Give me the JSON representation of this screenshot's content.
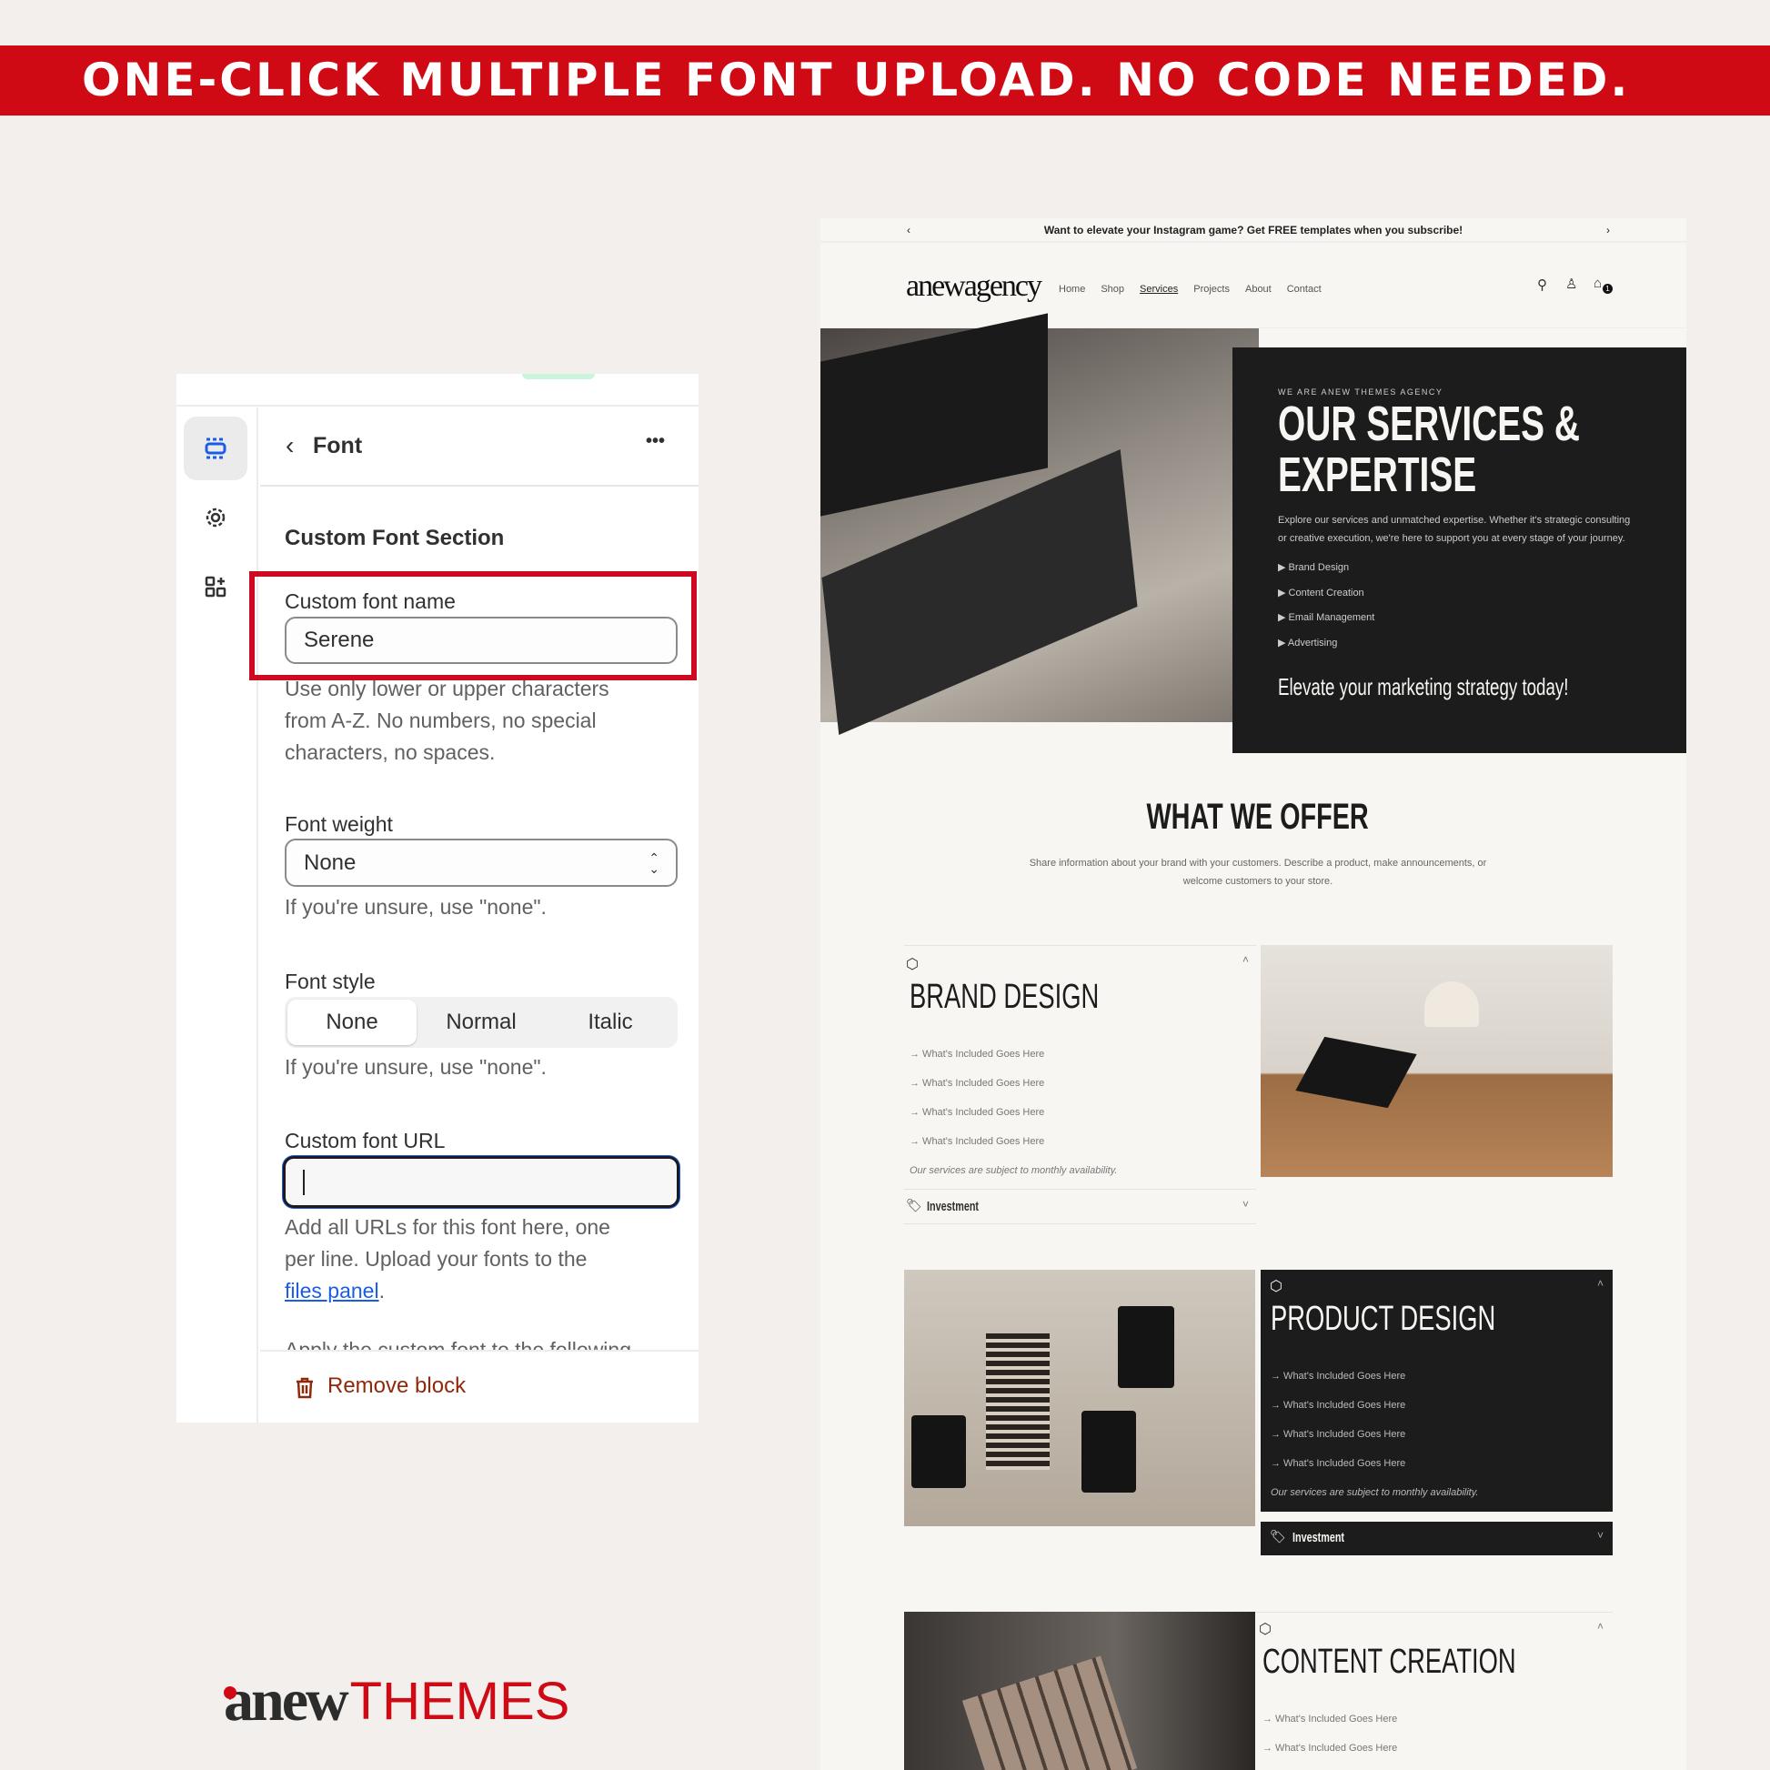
{
  "banner": {
    "text": "ONE-CLICK MULTIPLE FONT UPLOAD. NO CODE NEEDED."
  },
  "editor": {
    "sidebar": [
      {
        "icon": "sections-icon",
        "active": true
      },
      {
        "icon": "gear-icon"
      },
      {
        "icon": "apps-add-icon"
      }
    ],
    "header": {
      "title": "Font",
      "more": "•••"
    },
    "section_title": "Custom Font Section",
    "font_name": {
      "label": "Custom font name",
      "value": "Serene",
      "help": [
        "Use only lower or upper characters",
        "from A-Z. No numbers, no special",
        "characters, no spaces."
      ]
    },
    "font_weight": {
      "label": "Font weight",
      "value": "None",
      "help": "If you're unsure, use \"none\"."
    },
    "font_style": {
      "label": "Font style",
      "options": [
        "None",
        "Normal",
        "Italic"
      ],
      "selected": "None",
      "help": "If you're unsure, use \"none\"."
    },
    "font_url": {
      "label": "Custom font URL",
      "value": "",
      "help_lines": [
        "Add all URLs for this font here, one",
        "per line. Upload your fonts to the"
      ],
      "link": "files panel",
      "link_suffix": "."
    },
    "cutoff": "Apply the custom font to the following",
    "remove": "Remove block",
    "highlight_color": "#cf0a20"
  },
  "site": {
    "announcement": "Want to elevate your Instagram game? Get FREE templates when you subscribe!",
    "logo": "anewagency",
    "nav": [
      "Home",
      "Shop",
      "Services",
      "Projects",
      "About",
      "Contact"
    ],
    "active_nav": "Services",
    "cart_count": "1",
    "hero": {
      "eyebrow": "WE ARE ANEW THEMES AGENCY",
      "title1": "OUR SERVICES &",
      "title2": "EXPERTISE",
      "desc1": "Explore our services and unmatched expertise. Whether it's strategic consulting",
      "desc2": "or creative execution, we're here to support you at every stage of your journey.",
      "list": [
        "Brand Design",
        "Content Creation",
        "Email Management",
        "Advertising"
      ],
      "cta": "Elevate your marketing strategy today!"
    },
    "offer": {
      "title": "WHAT WE OFFER",
      "desc1": "Share information about your brand with your customers. Describe a product, make announcements, or",
      "desc2": "welcome customers to your store."
    },
    "services": [
      {
        "title": "BRAND DESIGN",
        "items": [
          "→ What's Included Goes Here",
          "→ What's Included Goes Here",
          "→ What's Included Goes Here",
          "→ What's Included Goes Here"
        ],
        "note": "Our services are subject to monthly availability.",
        "investment": "Investment"
      },
      {
        "title": "PRODUCT DESIGN",
        "items": [
          "→ What's Included Goes Here",
          "→ What's Included Goes Here",
          "→ What's Included Goes Here",
          "→ What's Included Goes Here"
        ],
        "note": "Our services are subject to monthly availability.",
        "investment": "Investment"
      },
      {
        "title": "CONTENT CREATION",
        "items": [
          "→ What's Included Goes Here",
          "→ What's Included Goes Here"
        ]
      }
    ]
  },
  "brand": {
    "logo_a": "anew",
    "logo_b": "THEMES",
    "color": "#cf0a14"
  }
}
